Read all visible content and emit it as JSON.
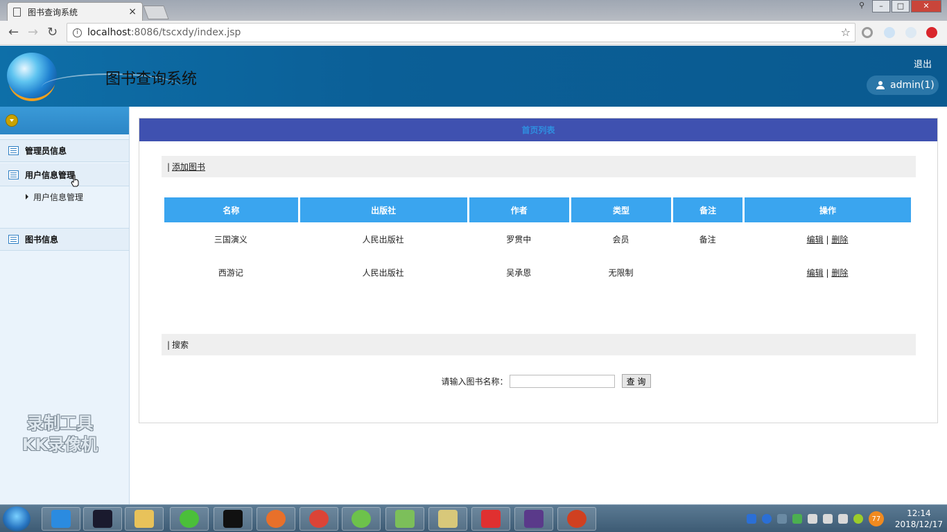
{
  "browser": {
    "tab_title": "图书查询系统",
    "tab_close": "×",
    "url_host": "localhost",
    "url_path": ":8086/tscxdy/index.jsp",
    "back": "←",
    "forward": "→",
    "reload": "↻",
    "star": "☆",
    "info": "i"
  },
  "header": {
    "title": "图书查询系统",
    "logout": "退出",
    "user": "admin(1)"
  },
  "sidebar": {
    "items": [
      {
        "label": "管理员信息"
      },
      {
        "label": "用户信息管理"
      },
      {
        "label": "图书信息"
      }
    ],
    "sub_items": [
      {
        "label": "用户信息管理"
      }
    ],
    "watermark_line1": "录制工具",
    "watermark_line2": "KK录像机"
  },
  "main": {
    "panel_title": "首页列表",
    "add_section": {
      "prefix": "|",
      "link": "添加图书"
    },
    "table": {
      "columns": [
        "名称",
        "出版社",
        "作者",
        "类型",
        "备注",
        "操作"
      ],
      "rows": [
        {
          "name": "三国演义",
          "publisher": "人民出版社",
          "author": "罗贯中",
          "type": "会员",
          "note": "备注",
          "edit": "编辑",
          "sep": "|",
          "delete": "删除"
        },
        {
          "name": "西游记",
          "publisher": "人民出版社",
          "author": "吴承恩",
          "type": "无限制",
          "note": "",
          "edit": "编辑",
          "sep": "|",
          "delete": "删除"
        }
      ]
    },
    "search_section": {
      "prefix": "|",
      "label": "搜索"
    },
    "search": {
      "label": "请输入图书名称：",
      "value": "",
      "button": "查 询"
    }
  },
  "taskbar": {
    "time": "12:14",
    "date": "2018/12/17",
    "badge": "77"
  },
  "colors": {
    "header_bg": "#0b5f97",
    "panel_head": "#3f51b0",
    "table_head": "#3aa5ef",
    "sidebar_bg": "#eaf3fb"
  }
}
